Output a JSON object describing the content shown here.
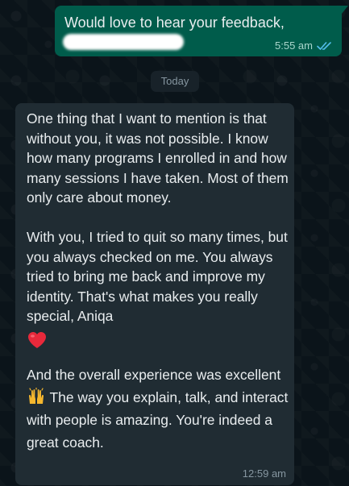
{
  "outgoing_message": {
    "text": "Would love to hear your feedback,",
    "time": "5:55 am",
    "status_icon": "double-check-read-icon"
  },
  "date_separator": {
    "label": "Today"
  },
  "incoming_message": {
    "paragraph_1": "One thing that I want to mention is that without you, it was not possible. I know how many programs I enrolled in and how many sessions I have taken. Most of them only care about money.",
    "paragraph_2": "With you, I tried to quit so many times, but you always checked on me. You always tried to bring me back and improve my identity. That's what makes you really special, Aniqa",
    "heart_emoji": "red-heart-icon",
    "paragraph_3_part1": "And the overall experience was excellent",
    "raising_hands_emoji": "raising-hands-icon",
    "paragraph_3_part2": "The way you explain, talk, and interact with people is amazing. You're indeed a great coach.",
    "time": "12:59 am"
  },
  "colors": {
    "background": "#0b141a",
    "outgoing_bubble": "#005c4b",
    "incoming_bubble": "#202c33",
    "read_ticks": "#53bdeb",
    "text": "#e9edef",
    "meta_text": "#8696a0"
  }
}
